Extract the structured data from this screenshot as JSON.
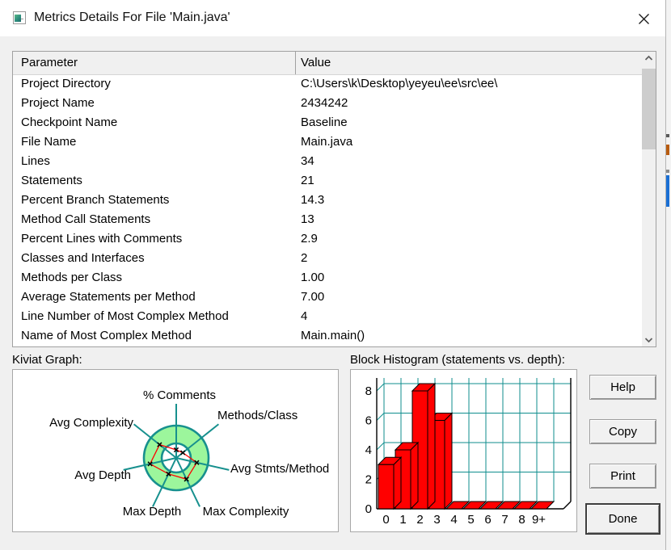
{
  "window": {
    "title": "Metrics Details For File 'Main.java'"
  },
  "table": {
    "columns": [
      "Parameter",
      "Value"
    ],
    "rows": [
      [
        "Project Directory",
        "C:\\Users\\k\\Desktop\\yeyeu\\ee\\src\\ee\\"
      ],
      [
        "Project Name",
        "2434242"
      ],
      [
        "Checkpoint Name",
        "Baseline"
      ],
      [
        "File Name",
        "Main.java"
      ],
      [
        "Lines",
        "34"
      ],
      [
        "Statements",
        "21"
      ],
      [
        "Percent Branch Statements",
        "14.3"
      ],
      [
        "Method Call Statements",
        "13"
      ],
      [
        "Percent Lines with Comments",
        "2.9"
      ],
      [
        "Classes and Interfaces",
        "2"
      ],
      [
        "Methods per Class",
        "1.00"
      ],
      [
        "Average Statements per Method",
        "7.00"
      ],
      [
        "Line Number of Most Complex Method",
        "4"
      ],
      [
        "Name of Most Complex Method",
        "Main.main()"
      ]
    ]
  },
  "sections": {
    "kiviat_label": "Kiviat Graph:",
    "histogram_label": "Block Histogram (statements vs. depth):"
  },
  "buttons": {
    "help": "Help",
    "copy": "Copy",
    "print": "Print",
    "done": "Done"
  },
  "colors": {
    "teal": "#17908e",
    "ring_green": "#9cf69c",
    "polygon_red": "#ff0000",
    "bar_red": "#ff0000",
    "grid_teal": "#0f8e8e"
  },
  "chart_data": [
    {
      "type": "radar",
      "title": "Kiviat Graph",
      "axes": [
        "% Comments",
        "Methods/Class",
        "Avg Stmts/Method",
        "Max Complexity",
        "Max Depth",
        "Avg Depth",
        "Avg Complexity"
      ],
      "values_radius_fraction": [
        0.25,
        0.26,
        0.65,
        0.73,
        0.55,
        0.83,
        0.66
      ],
      "ring": {
        "inner_fraction": 0.45,
        "outer_fraction": 1.0
      },
      "legend_position": "none",
      "grid": "ring-and-spokes"
    },
    {
      "type": "bar",
      "title": "Block Histogram (statements vs. depth)",
      "categories": [
        "0",
        "1",
        "2",
        "3",
        "4",
        "5",
        "6",
        "7",
        "8",
        "9+"
      ],
      "values": [
        3,
        4,
        8,
        6,
        0,
        0,
        0,
        0,
        0,
        0
      ],
      "xlabel": "",
      "ylabel": "",
      "yticks": [
        0,
        2,
        4,
        6,
        8
      ],
      "ylim": [
        0,
        8
      ],
      "grid": true,
      "style": "3d-blocks"
    }
  ]
}
